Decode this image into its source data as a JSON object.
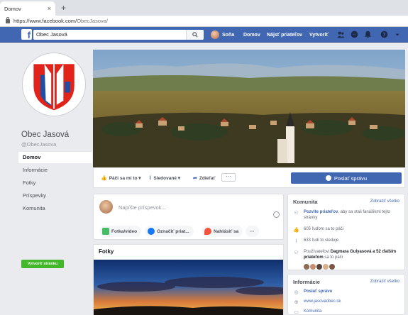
{
  "browser": {
    "tab_title": "Domov",
    "tab_close": "×",
    "new_tab": "+",
    "url_host": "https://www.facebook.com/",
    "url_path": "ObecJasova/"
  },
  "fb_header": {
    "logo": "f",
    "search_value": "Obec Jasová",
    "nav": {
      "user": "Soňa",
      "home": "Domov",
      "find_friends": "Nájsť priateľov",
      "create": "Vytvoriť"
    },
    "icons": [
      "friends-icon",
      "messenger-icon",
      "notifications-icon",
      "help-icon",
      "dropdown-icon"
    ]
  },
  "page": {
    "name": "Obec Jasová",
    "handle": "@ObecJasova",
    "nav_items": [
      {
        "label": "Domov",
        "active": true
      },
      {
        "label": "Informácie",
        "active": false
      },
      {
        "label": "Fotky",
        "active": false
      },
      {
        "label": "Príspevky",
        "active": false
      },
      {
        "label": "Komunita",
        "active": false
      }
    ],
    "create_page": "Vytvoriť stránku",
    "crest_colors": {
      "red": "#e2231a",
      "blue": "#1f4fa3",
      "white": "#ffffff"
    }
  },
  "actions": {
    "like": "Páči sa mi to",
    "follow": "Sledované",
    "share": "Zdieľať",
    "more": "···",
    "send_message": "Poslať správu"
  },
  "composer": {
    "placeholder": "Napíšte príspevok...",
    "photo_video": "Fotka/video",
    "tag_friends": "Označiť priat...",
    "checkin": "Nahlásiť sa",
    "more": "···"
  },
  "photos": {
    "title": "Fotky"
  },
  "community": {
    "title": "Komunita",
    "see_all": "Zobraziť všetko",
    "invite_link": "Pozvite priateľov",
    "invite_rest": ", aby sa stali fanúšikmi tejto stránky",
    "likes": "605 ľuďom sa to páči",
    "follows": "633 ľudí to sleduje",
    "friends_prefix": "Používateľovi ",
    "friends_names": "Dagmara Gulyasová a 52 ďalším priateľom",
    "friends_suffix": " sa to páči"
  },
  "info": {
    "title": "Informácie",
    "see_all": "Zobraziť všetko",
    "send_message": "Poslať správu",
    "website": "www.jasovaobec.sk",
    "category": "Komunita"
  },
  "colors": {
    "fb_blue": "#4267b2",
    "fb_green": "#42b72a",
    "background": "#e9ebee"
  }
}
